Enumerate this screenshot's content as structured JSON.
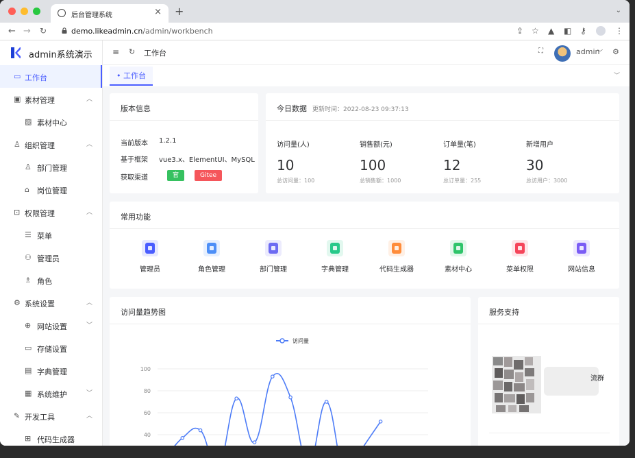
{
  "browser": {
    "tab_title": "后台管理系统",
    "url_host": "demo.likeadmin.cn",
    "url_path": "/admin/workbench"
  },
  "app": {
    "title": "admin系统演示",
    "brand_color": "#4a5dff"
  },
  "sidebar": {
    "items": [
      {
        "label": "工作台",
        "icon": "monitor-icon",
        "active": true
      },
      {
        "label": "素材管理",
        "icon": "image-icon",
        "arrow": "up"
      },
      {
        "label": "素材中心",
        "icon": "picture-icon",
        "sub": true
      },
      {
        "label": "组织管理",
        "icon": "user-icon",
        "arrow": "up"
      },
      {
        "label": "部门管理",
        "icon": "user-icon",
        "sub": true
      },
      {
        "label": "岗位管理",
        "icon": "badge-icon",
        "sub": true
      },
      {
        "label": "权限管理",
        "icon": "lock-icon",
        "arrow": "up"
      },
      {
        "label": "菜单",
        "icon": "menu-icon",
        "sub": true
      },
      {
        "label": "管理员",
        "icon": "users-icon",
        "sub": true
      },
      {
        "label": "角色",
        "icon": "role-icon",
        "sub": true
      },
      {
        "label": "系统设置",
        "icon": "gear-icon",
        "arrow": "up"
      },
      {
        "label": "网站设置",
        "icon": "globe-icon",
        "sub": true,
        "arrow": "down"
      },
      {
        "label": "存储设置",
        "icon": "folder-icon",
        "sub": true
      },
      {
        "label": "字典管理",
        "icon": "dictionary-icon",
        "sub": true
      },
      {
        "label": "系统维护",
        "icon": "maintenance-icon",
        "sub": true,
        "arrow": "down"
      },
      {
        "label": "开发工具",
        "icon": "pen-icon",
        "arrow": "up"
      },
      {
        "label": "代码生成器",
        "icon": "code-icon",
        "sub": true
      }
    ]
  },
  "topbar": {
    "breadcrumb": "工作台",
    "username": "admin"
  },
  "tagsbar": {
    "active_tag": "• 工作台"
  },
  "version_card": {
    "title": "版本信息",
    "rows": [
      {
        "key": "当前版本",
        "value": "1.2.1"
      },
      {
        "key": "基于框架",
        "value": "vue3.x、ElementUI、MySQL"
      },
      {
        "key": "获取渠道"
      }
    ],
    "btn_site": "官网",
    "btn_gitee": "Gitee"
  },
  "today_card": {
    "title": "今日数据",
    "updated": "更新时间：2022-08-23 09:37:13",
    "stats": [
      {
        "label": "访问量(人)",
        "value": "10",
        "sub": "总访问量：100"
      },
      {
        "label": "销售额(元)",
        "value": "100",
        "sub": "总销售额：1000"
      },
      {
        "label": "订单量(笔)",
        "value": "12",
        "sub": "总订单量：255"
      },
      {
        "label": "新增用户",
        "value": "30",
        "sub": "总访用户：3000"
      }
    ]
  },
  "functions_card": {
    "title": "常用功能",
    "items": [
      {
        "label": "管理员",
        "icon": "admin-icon",
        "color": "#4a5dff"
      },
      {
        "label": "角色管理",
        "icon": "role-manage-icon",
        "color": "#4d8ff7"
      },
      {
        "label": "部门管理",
        "icon": "department-icon",
        "color": "#6d6bf2"
      },
      {
        "label": "字典管理",
        "icon": "dictionary-icon",
        "color": "#28c98a"
      },
      {
        "label": "代码生成器",
        "icon": "code-generator-icon",
        "color": "#ff8c3a"
      },
      {
        "label": "素材中心",
        "icon": "material-icon",
        "color": "#2fc46a"
      },
      {
        "label": "菜单权限",
        "icon": "menu-permission-icon",
        "color": "#f5455a"
      },
      {
        "label": "网站信息",
        "icon": "website-info-icon",
        "color": "#7a5cf5"
      }
    ]
  },
  "trend_card": {
    "title": "访问量趋势图"
  },
  "support_card": {
    "title": "服务支持",
    "partial_text": "流群"
  },
  "chart_data": {
    "type": "line",
    "title": "",
    "legend": [
      "访问量"
    ],
    "y_ticks": [
      100,
      80,
      60,
      40
    ],
    "ylim": [
      20,
      100
    ],
    "series": [
      {
        "name": "访问量",
        "color": "#4d7cf7",
        "values": [
          18,
          37,
          44,
          10,
          73,
          33,
          93,
          74,
          12,
          70,
          3,
          28,
          52
        ]
      }
    ]
  }
}
